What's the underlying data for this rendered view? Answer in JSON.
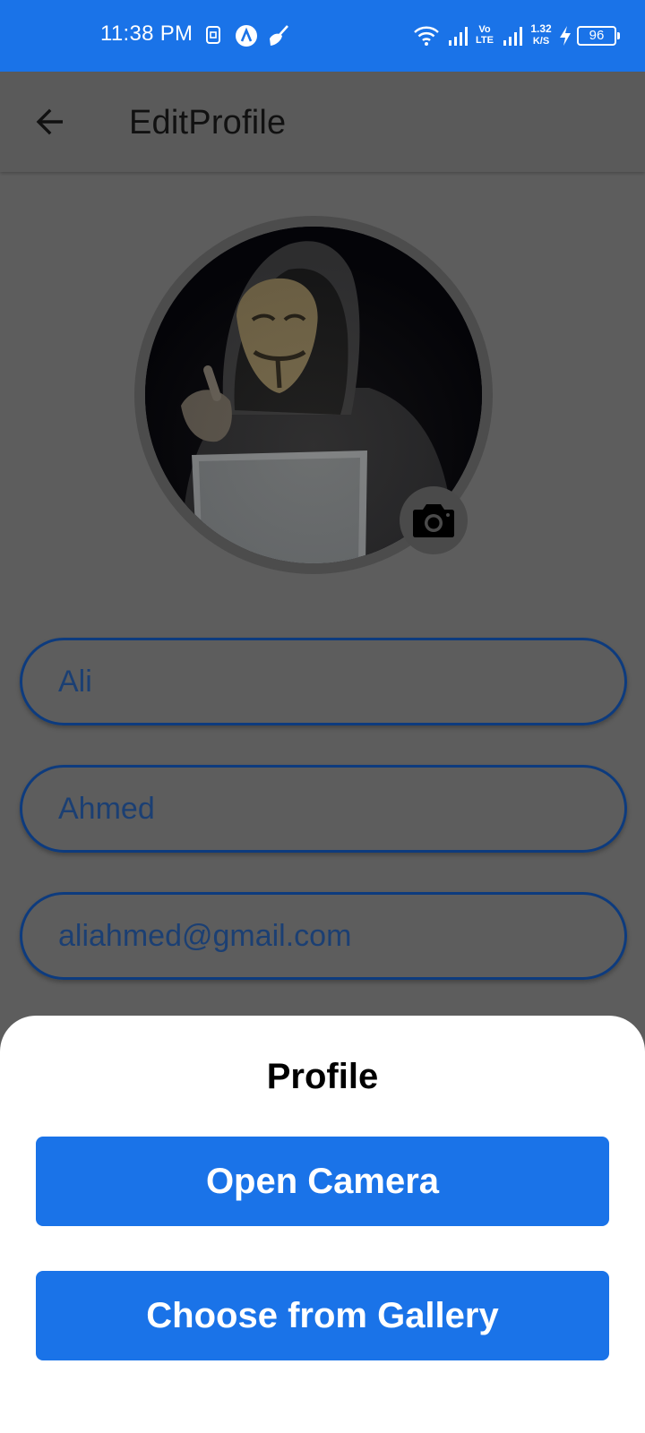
{
  "status_bar": {
    "time": "11:38 PM",
    "network_type": "Vo LTE",
    "speed_value": "1.32",
    "speed_unit": "K/S",
    "battery": "96",
    "icons": [
      "sim-icon",
      "a-badge-icon",
      "broom-icon",
      "wifi-icon",
      "signal-icon",
      "signal-icon-2",
      "charging-icon",
      "battery-icon"
    ]
  },
  "app_bar": {
    "title": "EditProfile",
    "back_icon": "arrow-left-icon"
  },
  "profile": {
    "avatar_description_icon": "profile-photo",
    "camera_icon": "camera-icon"
  },
  "form": {
    "first_name": "Ali",
    "last_name": "Ahmed",
    "email": "aliahmed@gmail.com"
  },
  "sheet": {
    "title": "Profile",
    "open_camera": "Open Camera",
    "choose_gallery": "Choose from Gallery"
  },
  "colors": {
    "accent": "#1a73e8",
    "field_border": "#0d3b7e",
    "scrim": "#5d5d5d"
  }
}
